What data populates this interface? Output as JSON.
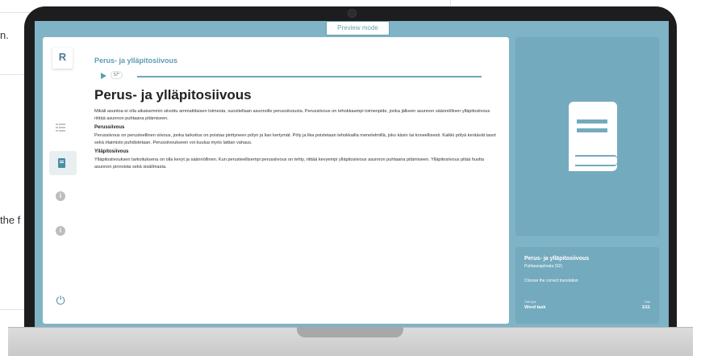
{
  "background": {
    "text_top": "n.",
    "text_mid": "the f"
  },
  "preview_badge": "Preview mode",
  "sidebar": {
    "logo": "R",
    "items": [
      {
        "icon": "grid-icon"
      },
      {
        "icon": "book-icon",
        "active": true
      },
      {
        "icon": "info-icon",
        "label": "i"
      },
      {
        "icon": "info-icon",
        "label": "i"
      }
    ],
    "power_icon": "⏻"
  },
  "content": {
    "breadcrumb": "Perus- ja ylläpitosiivous",
    "audio_duration": "57\"",
    "title": "Perus- ja ylläpitosiivous",
    "intro": "Mikäli asuntoa ei olla aikaisemmin siivottu ammattilaisen toimesta, suositellaan asunnolle perussiivousta. Perussiivous on tehokkaampi toimenpide, jonka jälkeen asunnon säännöllinen ylläpitosiivous riittää asunnon puhtaana pitämiseen.",
    "section1_heading": "Perussiivous",
    "section1_text": "Perussiivous on perusteellinen siivous, jonka tarkoitus on poistaa pinttyneen pölyn ja lian kertymät. Pöly ja lika poistetaan tehokkailla menetelmillä, joko käsin tai koneellisesti. Kaikki pölyä keräävät tasot sekä irtaimisto puhdistetaan. Perussiivoukseen voi kuulua myös lattian vahaus.",
    "section2_heading": "Ylläpitosiivous",
    "section2_text": "Ylläpitosiivouksen tarkoituksena on olla kevyt ja säännöllinen. Kun perusteellisempi perussiivous on tehty, riittää kevyempi ylläpitosiivous asunnon puhtaana pitämiseen. Ylläpitosiivous pitää huolta asunnon pinnoista sekä sisäilmasta."
  },
  "task_card": {
    "title": "Perus- ja ylläpitosiivous",
    "subtitle": "Puhtaanapitoala (S2)",
    "instruction": "Choose the correct translation",
    "type_label": "Task type",
    "type_value": "Word task",
    "task_label": "Task",
    "task_value": "1/11"
  },
  "colors": {
    "screen_bg": "#7fb3c6",
    "card_bg": "#74aabe",
    "accent": "#5e9db3",
    "laptop": "#1d1d1f"
  }
}
